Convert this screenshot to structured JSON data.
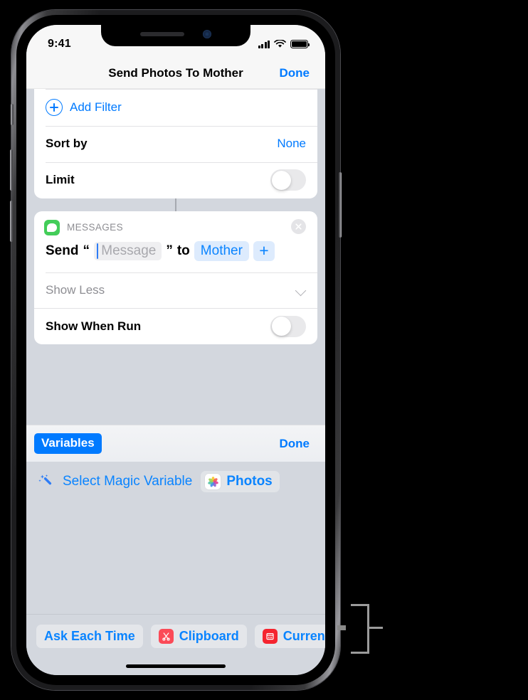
{
  "status_bar": {
    "time": "9:41",
    "signal_icon": "cellular-signal-icon",
    "wifi_icon": "wifi-icon",
    "battery_icon": "battery-full-icon"
  },
  "nav_bar": {
    "title": "Send Photos To Mother",
    "done_label": "Done"
  },
  "filters_card": {
    "add_filter_label": "Add Filter",
    "rows": [
      {
        "label": "Sort by",
        "value": "None",
        "type": "value"
      },
      {
        "label": "Limit",
        "value": "",
        "type": "toggle",
        "toggle_on": false
      }
    ]
  },
  "messages_card": {
    "app_name": "MESSAGES",
    "app_icon": "messages-app-icon",
    "close_icon": "close-circle-icon",
    "sentence": {
      "verb": "Send",
      "open_quote": "“",
      "field_placeholder": "Message",
      "close_quote": "”",
      "preposition": "to",
      "recipient_chip": "Mother",
      "add_recipient": "+"
    },
    "show_less_label": "Show Less",
    "show_less_icon": "chevron-down-icon",
    "show_when_run": {
      "label": "Show When Run",
      "toggle_on": false
    }
  },
  "variables_bar": {
    "variables_label": "Variables",
    "done_label": "Done"
  },
  "variables_panel": {
    "magic_wand_icon": "magic-wand-icon",
    "select_magic_variable_label": "Select Magic Variable",
    "photos_chip": {
      "icon": "photos-app-icon",
      "label": "Photos"
    }
  },
  "suggestion_bar": {
    "chips": [
      {
        "label": "Ask Each Time",
        "icon": null
      },
      {
        "label": "Clipboard",
        "icon": "clipboard-scissors-icon"
      },
      {
        "label": "Current D",
        "icon": "calendar-icon"
      }
    ]
  },
  "colors": {
    "accent_blue": "#007aff",
    "chip_blue": "#0a84ff",
    "chip_bg": "#ddebfd",
    "messages_green": "#43cd59",
    "panel_bg": "#d3d7de",
    "callout_gray": "#9b9b9b"
  }
}
